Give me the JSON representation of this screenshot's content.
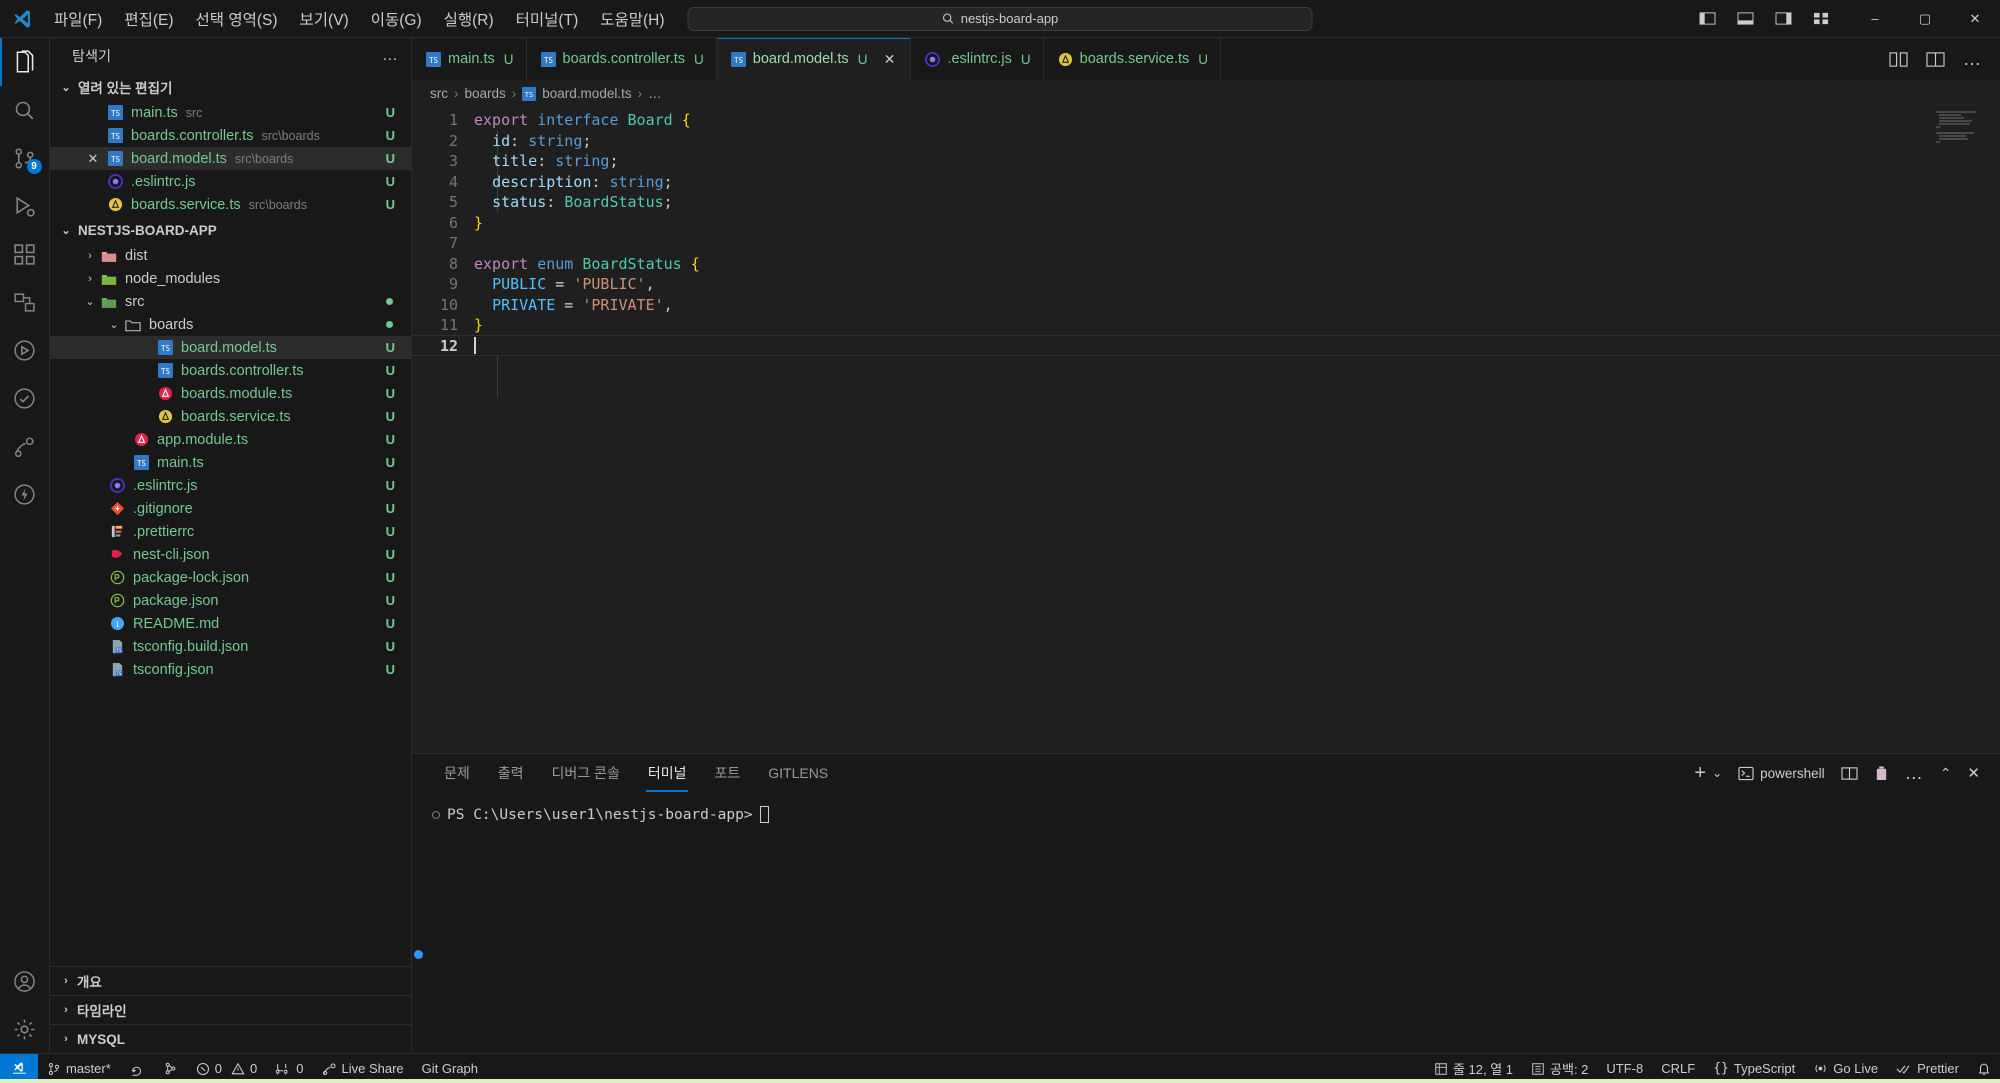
{
  "titlebar": {
    "menus": [
      "파일(F)",
      "편집(E)",
      "선택 영역(S)",
      "보기(V)",
      "이동(G)",
      "실행(R)",
      "터미널(T)",
      "도움말(H)"
    ],
    "back_icon": "arrow-left-icon",
    "forward_icon": "arrow-right-icon",
    "command_center": {
      "text": "nestjs-board-app",
      "icon": "search-icon"
    },
    "layout_icons": [
      "toggle-primary-sidebar-icon",
      "toggle-panel-icon",
      "toggle-secondary-sidebar-icon",
      "customize-layout-icon"
    ],
    "window_controls": {
      "minimize": "–",
      "maximize": "▢",
      "close": "✕"
    }
  },
  "activitybar": {
    "items": [
      {
        "name": "explorer",
        "icon": "files-icon",
        "active": true
      },
      {
        "name": "search",
        "icon": "search-icon",
        "active": false
      },
      {
        "name": "source-control",
        "icon": "source-control-icon",
        "active": false,
        "badge": "9"
      },
      {
        "name": "run-and-debug",
        "icon": "run-debug-icon",
        "active": false
      },
      {
        "name": "extensions",
        "icon": "extensions-icon",
        "active": false
      },
      {
        "name": "remote-explorer",
        "icon": "remote-explorer-icon",
        "active": false
      },
      {
        "name": "testing",
        "icon": "beaker-icon",
        "active": false
      },
      {
        "name": "todo-tree",
        "icon": "checklist-icon",
        "active": false
      },
      {
        "name": "live-share",
        "icon": "live-share-icon",
        "active": false
      },
      {
        "name": "thunder-client",
        "icon": "thunder-icon",
        "active": false
      }
    ],
    "bottom": [
      {
        "name": "accounts",
        "icon": "account-icon"
      },
      {
        "name": "manage",
        "icon": "gear-icon"
      }
    ]
  },
  "sidebar": {
    "title": "탐색기",
    "more_actions": "…",
    "open_editors": {
      "label": "열려 있는 편집기",
      "expanded": true,
      "items": [
        {
          "name": "main.ts",
          "desc": "src",
          "badge": "U",
          "icon": "ts-icon",
          "selected": false,
          "close": false
        },
        {
          "name": "boards.controller.ts",
          "desc": "src\\boards",
          "badge": "U",
          "icon": "ts-icon",
          "selected": false,
          "close": false
        },
        {
          "name": "board.model.ts",
          "desc": "src\\boards",
          "badge": "U",
          "icon": "ts-icon",
          "selected": true,
          "close": true
        },
        {
          "name": ".eslintrc.js",
          "desc": "",
          "badge": "U",
          "icon": "eslint-icon",
          "selected": false,
          "close": false
        },
        {
          "name": "boards.service.ts",
          "desc": "src\\boards",
          "badge": "U",
          "icon": "nest-service-icon",
          "selected": false,
          "close": false
        }
      ]
    },
    "project": {
      "label": "NESTJS-BOARD-APP",
      "expanded": true,
      "tree": [
        {
          "name": "dist",
          "type": "folder",
          "depth": 1,
          "expanded": false,
          "icon": "folder-dist-icon",
          "badge": ""
        },
        {
          "name": "node_modules",
          "type": "folder",
          "depth": 1,
          "expanded": false,
          "icon": "folder-node-icon",
          "badge": ""
        },
        {
          "name": "src",
          "type": "folder",
          "depth": 1,
          "expanded": true,
          "icon": "folder-src-icon",
          "badge": "dot"
        },
        {
          "name": "boards",
          "type": "folder",
          "depth": 2,
          "expanded": true,
          "icon": "folder-open-icon",
          "badge": "dot"
        },
        {
          "name": "board.model.ts",
          "type": "file",
          "depth": 3,
          "icon": "ts-icon",
          "badge": "U",
          "selected": true
        },
        {
          "name": "boards.controller.ts",
          "type": "file",
          "depth": 3,
          "icon": "ts-icon",
          "badge": "U"
        },
        {
          "name": "boards.module.ts",
          "type": "file",
          "depth": 3,
          "icon": "nest-module-icon",
          "badge": "U"
        },
        {
          "name": "boards.service.ts",
          "type": "file",
          "depth": 3,
          "icon": "nest-service-icon",
          "badge": "U"
        },
        {
          "name": "app.module.ts",
          "type": "file",
          "depth": 2,
          "icon": "nest-module-icon",
          "badge": "U"
        },
        {
          "name": "main.ts",
          "type": "file",
          "depth": 2,
          "icon": "ts-icon",
          "badge": "U"
        },
        {
          "name": ".eslintrc.js",
          "type": "file",
          "depth": 1,
          "icon": "eslint-icon",
          "badge": "U"
        },
        {
          "name": ".gitignore",
          "type": "file",
          "depth": 1,
          "icon": "git-icon",
          "badge": "U"
        },
        {
          "name": ".prettierrc",
          "type": "file",
          "depth": 1,
          "icon": "prettier-icon",
          "badge": "U"
        },
        {
          "name": "nest-cli.json",
          "type": "file",
          "depth": 1,
          "icon": "nest-icon",
          "badge": "U"
        },
        {
          "name": "package-lock.json",
          "type": "file",
          "depth": 1,
          "icon": "npm-icon",
          "badge": "U"
        },
        {
          "name": "package.json",
          "type": "file",
          "depth": 1,
          "icon": "npm-icon",
          "badge": "U"
        },
        {
          "name": "README.md",
          "type": "file",
          "depth": 1,
          "icon": "readme-icon",
          "badge": "U"
        },
        {
          "name": "tsconfig.build.json",
          "type": "file",
          "depth": 1,
          "icon": "tsconfig-icon",
          "badge": "U"
        },
        {
          "name": "tsconfig.json",
          "type": "file",
          "depth": 1,
          "icon": "tsconfig-icon",
          "badge": "U"
        }
      ]
    },
    "collapsed_sections": [
      "개요",
      "타임라인",
      "MYSQL"
    ]
  },
  "editor": {
    "tabs": [
      {
        "label": "main.ts",
        "badge": "U",
        "icon": "ts-icon",
        "active": false,
        "dirty": false
      },
      {
        "label": "boards.controller.ts",
        "badge": "U",
        "icon": "ts-icon",
        "active": false,
        "dirty": false
      },
      {
        "label": "board.model.ts",
        "badge": "U",
        "icon": "ts-icon",
        "active": true,
        "dirty": false,
        "close": "✕"
      },
      {
        "label": ".eslintrc.js",
        "badge": "U",
        "icon": "eslint-icon",
        "active": false,
        "dirty": false
      },
      {
        "label": "boards.service.ts",
        "badge": "U",
        "icon": "nest-service-icon",
        "active": false,
        "dirty": false
      }
    ],
    "tab_actions": [
      "split-editor-icon",
      "open-changes-icon",
      "more-actions-icon"
    ],
    "breadcrumb": [
      "src",
      "boards",
      "board.model.ts",
      "…"
    ],
    "line_numbers": [
      "1",
      "2",
      "3",
      "4",
      "5",
      "6",
      "7",
      "8",
      "9",
      "10",
      "11",
      "12"
    ],
    "current_line": 12,
    "code_lines": [
      [
        {
          "t": "export",
          "c": "t-kw"
        },
        {
          "t": " ",
          "c": "t-pun"
        },
        {
          "t": "interface",
          "c": "t-kw2"
        },
        {
          "t": " ",
          "c": "t-pun"
        },
        {
          "t": "Board",
          "c": "t-type"
        },
        {
          "t": " ",
          "c": "t-pun"
        },
        {
          "t": "{",
          "c": "t-br1"
        }
      ],
      [
        {
          "t": "  ",
          "c": "t-pun"
        },
        {
          "t": "id",
          "c": "t-var"
        },
        {
          "t": ": ",
          "c": "t-pun"
        },
        {
          "t": "string",
          "c": "t-kw2"
        },
        {
          "t": ";",
          "c": "t-pun"
        }
      ],
      [
        {
          "t": "  ",
          "c": "t-pun"
        },
        {
          "t": "title",
          "c": "t-var"
        },
        {
          "t": ": ",
          "c": "t-pun"
        },
        {
          "t": "string",
          "c": "t-kw2"
        },
        {
          "t": ";",
          "c": "t-pun"
        }
      ],
      [
        {
          "t": "  ",
          "c": "t-pun"
        },
        {
          "t": "description",
          "c": "t-var"
        },
        {
          "t": ": ",
          "c": "t-pun"
        },
        {
          "t": "string",
          "c": "t-kw2"
        },
        {
          "t": ";",
          "c": "t-pun"
        }
      ],
      [
        {
          "t": "  ",
          "c": "t-pun"
        },
        {
          "t": "status",
          "c": "t-var"
        },
        {
          "t": ": ",
          "c": "t-pun"
        },
        {
          "t": "BoardStatus",
          "c": "t-type"
        },
        {
          "t": ";",
          "c": "t-pun"
        }
      ],
      [
        {
          "t": "}",
          "c": "t-br1"
        }
      ],
      [],
      [
        {
          "t": "export",
          "c": "t-kw"
        },
        {
          "t": " ",
          "c": "t-pun"
        },
        {
          "t": "enum",
          "c": "t-kw2"
        },
        {
          "t": " ",
          "c": "t-pun"
        },
        {
          "t": "BoardStatus",
          "c": "t-type"
        },
        {
          "t": " ",
          "c": "t-pun"
        },
        {
          "t": "{",
          "c": "t-br1"
        }
      ],
      [
        {
          "t": "  ",
          "c": "t-pun"
        },
        {
          "t": "PUBLIC",
          "c": "t-const"
        },
        {
          "t": " = ",
          "c": "t-op"
        },
        {
          "t": "'PUBLIC'",
          "c": "t-str"
        },
        {
          "t": ",",
          "c": "t-pun"
        }
      ],
      [
        {
          "t": "  ",
          "c": "t-pun"
        },
        {
          "t": "PRIVATE",
          "c": "t-const"
        },
        {
          "t": " = ",
          "c": "t-op"
        },
        {
          "t": "'PRIVATE'",
          "c": "t-str"
        },
        {
          "t": ",",
          "c": "t-pun"
        }
      ],
      [
        {
          "t": "}",
          "c": "t-br1"
        }
      ],
      []
    ],
    "code_plain": [
      "export interface Board {",
      "  id: string;",
      "  title: string;",
      "  description: string;",
      "  status: BoardStatus;",
      "}",
      "",
      "export enum BoardStatus {",
      "  PUBLIC = 'PUBLIC',",
      "  PRIVATE = 'PRIVATE',",
      "}",
      ""
    ]
  },
  "panel": {
    "tabs": [
      {
        "label": "문제",
        "active": false
      },
      {
        "label": "출력",
        "active": false
      },
      {
        "label": "디버그 콘솔",
        "active": false
      },
      {
        "label": "터미널",
        "active": true
      },
      {
        "label": "포트",
        "active": false
      },
      {
        "label": "GITLENS",
        "active": false
      }
    ],
    "actions": {
      "new_terminal": "+",
      "new_terminal_dropdown": "⌄",
      "shell_name": "powershell",
      "shell_icon": "terminal-icon",
      "split_icon": "split-terminal-icon",
      "kill_icon": "trash-icon",
      "more_icon": "more-actions-icon",
      "maximize_icon": "chevron-up-icon",
      "close_icon": "close-icon"
    },
    "terminal_prompt": "PS C:\\Users\\user1\\nestjs-board-app>"
  },
  "statusbar": {
    "remote_icon": "remote-window-icon",
    "left": [
      {
        "icon": "source-control-icon",
        "label": "master*"
      },
      {
        "icon": "sync-icon",
        "label": ""
      },
      {
        "icon": "gitlens-icon",
        "label": ""
      },
      {
        "icon": "error-icon",
        "label": "0",
        "icon2": "warning-icon",
        "label2": "0"
      },
      {
        "icon": "ports-icon",
        "label": "0"
      },
      {
        "icon": "live-share-icon",
        "label": "Live Share"
      },
      {
        "icon": "",
        "label": "Git Graph"
      }
    ],
    "right": [
      {
        "icon": "line-col-icon",
        "label": "줄 12, 열 1"
      },
      {
        "icon": "indent-icon",
        "label": "공백: 2"
      },
      {
        "icon": "",
        "label": "UTF-8"
      },
      {
        "icon": "",
        "label": "CRLF"
      },
      {
        "icon": "braces-icon",
        "label": "TypeScript"
      },
      {
        "icon": "broadcast-icon",
        "label": "Go Live"
      },
      {
        "icon": "check-icon",
        "label": "Prettier"
      },
      {
        "icon": "bell-icon",
        "label": ""
      }
    ]
  }
}
